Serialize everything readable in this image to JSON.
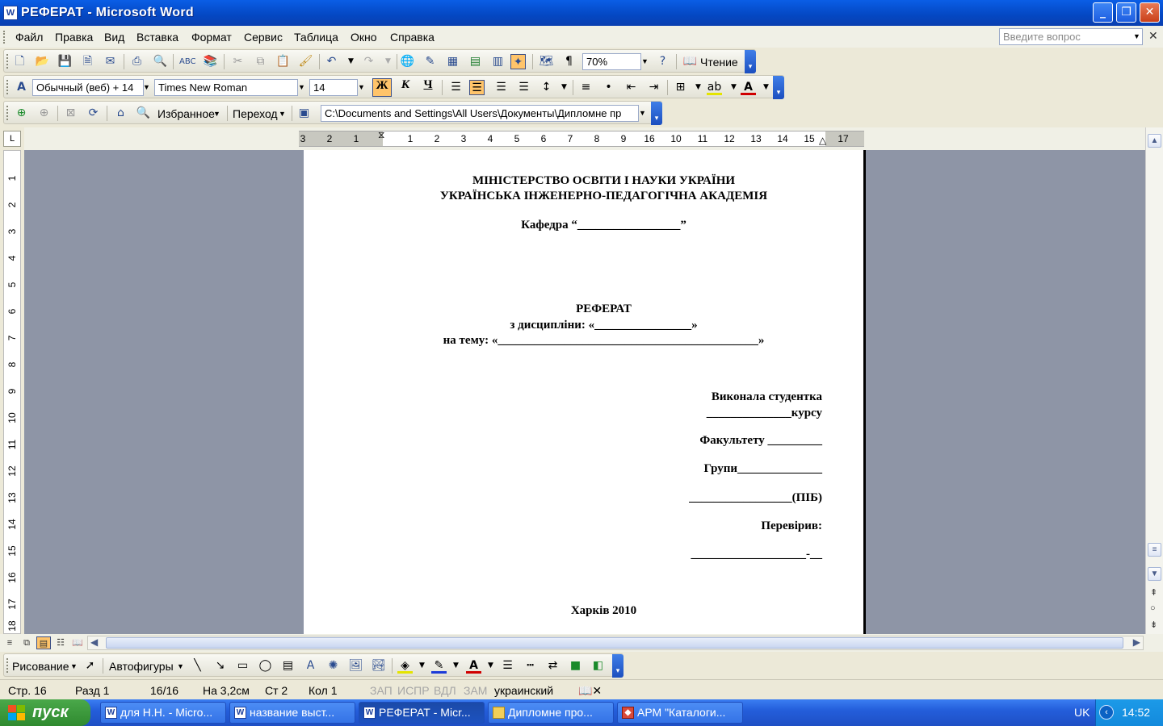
{
  "window": {
    "title": "РЕФЕРАТ - Microsoft Word",
    "app_icon": "W"
  },
  "menu": {
    "items": [
      "Файл",
      "Правка",
      "Вид",
      "Вставка",
      "Формат",
      "Сервис",
      "Таблица",
      "Окно",
      "Справка"
    ],
    "help_placeholder": "Введите вопрос"
  },
  "standard_toolbar": {
    "zoom": "70%",
    "reading_label": "Чтение"
  },
  "formatting_toolbar": {
    "style": "Обычный (веб) + 14",
    "font": "Times New Roman",
    "size": "14",
    "bold": "Ж",
    "italic": "К",
    "underline": "Ч"
  },
  "web_toolbar": {
    "favorites": "Избранное",
    "go": "Переход",
    "address": "C:\\Documents and Settings\\All Users\\Документы\\Дипломне пр"
  },
  "ruler": {
    "corner": "L",
    "h_marks": [
      "3",
      "2",
      "1",
      "",
      "1",
      "2",
      "3",
      "4",
      "5",
      "6",
      "7",
      "8",
      "9",
      "10",
      "11",
      "12",
      "13",
      "14",
      "15",
      "16",
      "",
      "17"
    ],
    "v_marks": [
      "1",
      "2",
      "3",
      "4",
      "5",
      "6",
      "7",
      "8",
      "9",
      "10",
      "11",
      "12",
      "13",
      "14",
      "15",
      "16",
      "17",
      "18"
    ]
  },
  "document": {
    "ministry": "МІНІСТЕРСТВО ОСВІТИ І НАУКИ УКРАЇНИ",
    "academy": "УКРАЇНСЬКА ІНЖЕНЕРНО-ПЕДАГОГІЧНА АКАДЕМІЯ",
    "department": "Кафедра “_________________”",
    "title": "РЕФЕРАТ",
    "discipline": "з дисципліни: «________________»",
    "topic": "на тему: «___________________________________________»",
    "performed": "Виконала студентка",
    "course": "______________курсу",
    "faculty": "Факультету _________",
    "group": "Групи______________",
    "name": "_________________(ПІБ)",
    "checked": "Перевірив:",
    "checker": "___________________-__",
    "city_year": "Харків 2010"
  },
  "drawing_toolbar": {
    "drawing": "Рисование",
    "autoshapes": "Автофигуры"
  },
  "status": {
    "page": "Стр. 16",
    "section": "Разд 1",
    "pages": "16/16",
    "at": "На 3,2см",
    "line": "Ст 2",
    "col": "Кол 1",
    "rec": "ЗАП",
    "trk": "ИСПР",
    "ext": "ВДЛ",
    "ovr": "ЗАМ",
    "language": "украинский"
  },
  "taskbar": {
    "start": "пуск",
    "tasks": [
      {
        "label": "для Н.Н. - Micro...",
        "icon": "W"
      },
      {
        "label": "название выст...",
        "icon": "W"
      },
      {
        "label": "РЕФЕРАТ - Micr...",
        "icon": "W"
      },
      {
        "label": "Дипломне про...",
        "icon": "folder"
      },
      {
        "label": "АРМ \"Каталоги...",
        "icon": "app"
      }
    ],
    "lang": "UK",
    "time": "14:52"
  }
}
